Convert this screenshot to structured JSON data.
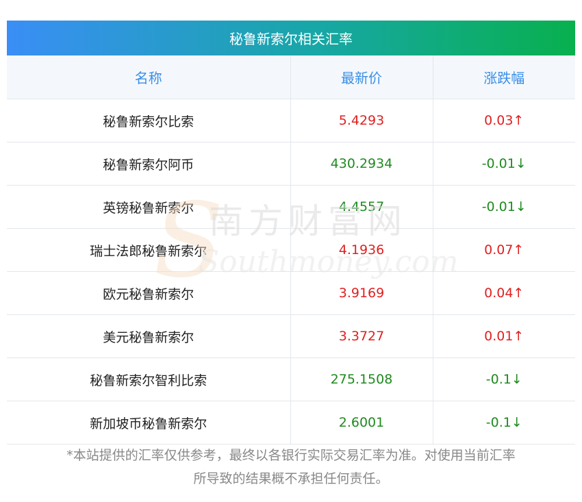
{
  "banner_title": "秘鲁新索尔相关汇率",
  "table": {
    "headers": [
      "名称",
      "最新价",
      "涨跌幅"
    ],
    "rows": [
      {
        "name": "秘鲁新索尔比索",
        "price": "5.4293",
        "change": "0.03↑",
        "trend": "up"
      },
      {
        "name": "秘鲁新索尔阿币",
        "price": "430.2934",
        "change": "-0.01↓",
        "trend": "down"
      },
      {
        "name": "英镑秘鲁新索尔",
        "price": "4.4557",
        "change": "-0.01↓",
        "trend": "down"
      },
      {
        "name": "瑞士法郎秘鲁新索尔",
        "price": "4.1936",
        "change": "0.07↑",
        "trend": "up"
      },
      {
        "name": "欧元秘鲁新索尔",
        "price": "3.9169",
        "change": "0.04↑",
        "trend": "up"
      },
      {
        "name": "美元秘鲁新索尔",
        "price": "3.3727",
        "change": "0.01↑",
        "trend": "up"
      },
      {
        "name": "秘鲁新索尔智利比索",
        "price": "275.1508",
        "change": "-0.1↓",
        "trend": "down"
      },
      {
        "name": "新加坡币秘鲁新索尔",
        "price": "2.6001",
        "change": "-0.1↓",
        "trend": "down"
      }
    ]
  },
  "watermark": {
    "cn": "南方财富网",
    "en": "Southmoney.com"
  },
  "footnote_line1": "*本站提供的汇率仅供参考，最终以各银行实际交易汇率为准。对使用当前汇率",
  "footnote_line2": "所导致的结果概不承担任何责任。",
  "colors": {
    "up": "#e02020",
    "down": "#1e8a1e",
    "header_text": "#3a8ee6",
    "banner_start": "#3a8ef6",
    "banner_end": "#08b04e"
  }
}
